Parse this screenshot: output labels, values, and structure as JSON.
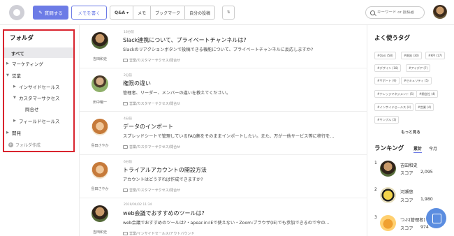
{
  "header": {
    "question_label": "質問する",
    "memo_label": "メモを書く",
    "filters": [
      "Q&A ▾",
      "メモ",
      "ブックマーク",
      "自分の投稿"
    ],
    "sort_label": "⇅",
    "search_placeholder": "キーワード or 投稿者"
  },
  "folders": {
    "title": "フォルダ",
    "items": [
      {
        "label": "すべて",
        "caret": ""
      },
      {
        "label": "マーケティング",
        "caret": "▶"
      },
      {
        "label": "営業",
        "caret": "▼"
      },
      {
        "label": "インサイドセールス",
        "caret": "▶"
      },
      {
        "label": "カスタマーサクセス",
        "caret": "▼"
      },
      {
        "label": "問合せ",
        "caret": ""
      },
      {
        "label": "フィールドセールス",
        "caret": "▶"
      },
      {
        "label": "開発",
        "caret": "▶"
      }
    ],
    "add_label": "フォルダ作成"
  },
  "posts": [
    {
      "time": "16分前",
      "title": "Slack連携について、プライベートチャンネルは?",
      "body": "Slackのリアクションボタンで投稿できる機能について、プライベートチャンネルに反応しますか?",
      "author": "吉田和史",
      "folder": "営業/カスタマーサクセス/問合せ"
    },
    {
      "time": "2分前",
      "title": "権限の違い",
      "body": "管理者、リーダー、メンバーの違いを教えてください。",
      "author": "田中暢一",
      "folder": "営業/カスタマーサクセス/問合せ"
    },
    {
      "time": "4分前",
      "title": "データのインポート",
      "body": "スプレッドシートで管理しているFAQ集をそのままインポートしたい。また、万が一他サービス等に移行を...",
      "author": "島田さやか",
      "folder": "営業/カスタマーサクセス/問合せ"
    },
    {
      "time": "6分前",
      "title": "トライアルアカウントの開設方法",
      "body": "アカウントはどうすれば作成できますか?",
      "author": "島田さやか",
      "folder": "営業/カスタマーサクセス/問合せ"
    },
    {
      "time": "2019/04/02 11:34",
      "title": "web会議でおすすめのツールは?",
      "body": "web会議でおすすめのツールは?・apear.in:IEで使えない・Zoom:ブラウザ(IE)でも参加できるので今の...",
      "author": "吉田和史",
      "folder": "営業/インサイドセールス/アウトバウンド"
    }
  ],
  "tags": {
    "title": "よく使うタグ",
    "items": [
      "#Qasi (58)",
      "#開発 (30)",
      "#KPI (17)",
      "#デザイン (18)",
      "#アイデア (7)",
      "#サポート (9)",
      "#セキュリティ (5)",
      "#ナレッジマネジメント (5)",
      "#開会社 (4)",
      "#インサイドセールス (4)",
      "#営業 (4)",
      "#サンプル (3)"
    ],
    "more_label": "もっと見る"
  },
  "ranking": {
    "title": "ランキング",
    "tabs": [
      "累計",
      "今月"
    ],
    "entries": [
      {
        "rank": "1",
        "name": "吉田和史",
        "score_label": "スコア",
        "score": "2,095"
      },
      {
        "rank": "2",
        "name": "河瀬悠",
        "score_label": "スコア",
        "score": "1,980"
      },
      {
        "rank": "3",
        "name": "つぶ(管理者)",
        "score_label": "スコア",
        "score": "974"
      }
    ]
  },
  "colors": {
    "accent": "#6c7be6",
    "highlight_border": "#d9232e"
  }
}
